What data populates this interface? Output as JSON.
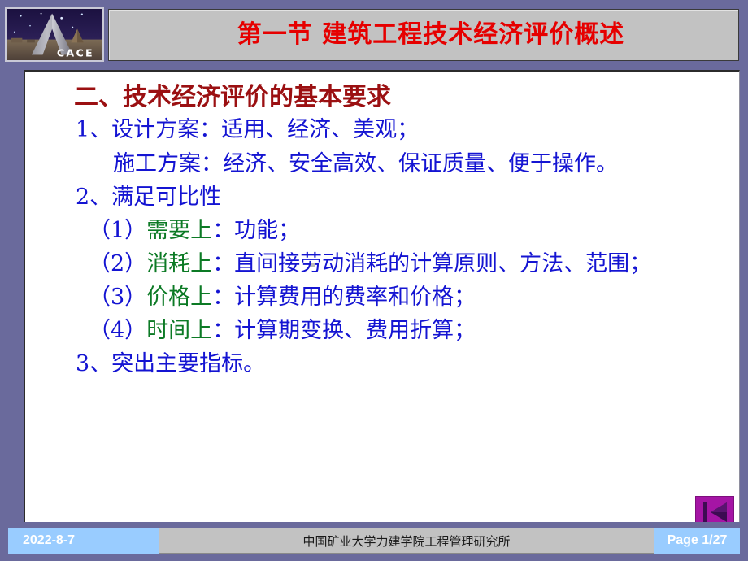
{
  "header": {
    "title": "第一节  建筑工程技术经济评价概述",
    "title_color": "#e60000",
    "panel_color": "#c2c2c2",
    "logo": {
      "name": "cace-logo",
      "wordmark": "CACE"
    }
  },
  "slide": {
    "frame_color": "#6a6a9c",
    "body_background": "#ffffff",
    "heading": "二、技术经济评价的基本要求",
    "heading_color": "#9b1012",
    "text_blue": "#1414d2",
    "text_green": "#0c7a25",
    "lines": [
      {
        "id": "item-1",
        "indent": "indent-1",
        "segments": [
          {
            "text": "1、设计方案：适用、经济、美观；",
            "color": "blue"
          }
        ]
      },
      {
        "id": "item-1-sub",
        "indent": "indent-2",
        "segments": [
          {
            "text": "施工方案：经济、安全高效、保证质量、便于操作。",
            "color": "blue"
          }
        ]
      },
      {
        "id": "item-2",
        "indent": "indent-1",
        "segments": [
          {
            "text": "2、满足可比性",
            "color": "blue"
          }
        ]
      },
      {
        "id": "item-2-1",
        "indent": "indent-p",
        "segments": [
          {
            "text": "（1）",
            "color": "blue"
          },
          {
            "text": "需要上",
            "color": "green"
          },
          {
            "text": "：功能；",
            "color": "blue"
          }
        ]
      },
      {
        "id": "item-2-2",
        "indent": "indent-p",
        "segments": [
          {
            "text": "（2）",
            "color": "blue"
          },
          {
            "text": "消耗上",
            "color": "green"
          },
          {
            "text": "：直间接劳动消耗的计算原则、方法、范围；",
            "color": "blue"
          }
        ]
      },
      {
        "id": "item-2-3",
        "indent": "indent-p",
        "segments": [
          {
            "text": "（3）",
            "color": "blue"
          },
          {
            "text": "价格上",
            "color": "green"
          },
          {
            "text": "：计算费用的费率和价格；",
            "color": "blue"
          }
        ]
      },
      {
        "id": "item-2-4",
        "indent": "indent-p",
        "segments": [
          {
            "text": "（4）",
            "color": "blue"
          },
          {
            "text": "时间上",
            "color": "green"
          },
          {
            "text": "：计算期变换、费用折算；",
            "color": "blue"
          }
        ]
      },
      {
        "id": "item-3",
        "indent": "indent-1",
        "segments": [
          {
            "text": "3、突出主要指标。",
            "color": "blue"
          }
        ]
      }
    ]
  },
  "nav": {
    "first_slide_button": {
      "name": "go-to-first-slide-button",
      "icon": "skip-to-start-icon",
      "color": "#a515a5"
    }
  },
  "footer": {
    "date": "2022-8-7",
    "organization": "中国矿业大学力建学院工程管理研究所",
    "page_label": "Page 1/27",
    "accent_color": "#99ccff",
    "band_color": "#c2c2c2"
  }
}
